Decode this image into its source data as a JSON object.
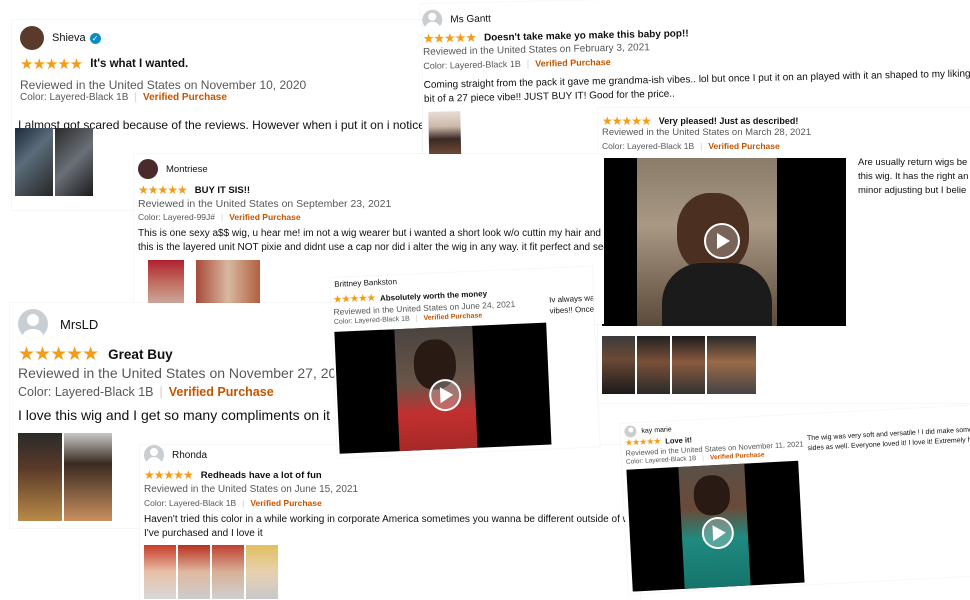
{
  "colors": {
    "star": "#f59b14",
    "verified": "#c45500",
    "meta": "#565959"
  },
  "reviews": {
    "shieva": {
      "name": "Shieva",
      "stars": "★★★★★",
      "title": "It's what I wanted.",
      "meta": "Reviewed in the United States on November 10, 2020",
      "variant": "Color: Layered-Black 1B",
      "verified": "Verified Purchase",
      "body": "I almost got scared because of the reviews. However when i put it on i noticed it"
    },
    "gantt": {
      "name": "Ms Gantt",
      "stars": "★★★★★",
      "title": "Doesn't take make yo make this baby pop!!",
      "meta": "Reviewed in the United States on February 3, 2021",
      "variant": "Color: Layered-Black 1B",
      "verified": "Verified Purchase",
      "body1": "Coming straight from the pack it gave me grandma-ish vibes.. lol but once I put it on an played with it an shaped to my liking, di",
      "body2": "bit of a 27 piece vibe!! JUST BUY IT! Good for the price.."
    },
    "pleased": {
      "stars": "★★★★★",
      "title": "Very pleased! Just as described!",
      "meta": "Reviewed in the United States on March 28, 2021",
      "variant": "Color: Layered-Black 1B",
      "verified": "Verified Purchase",
      "side1": "Are usually return wigs be",
      "side2": "this wig. It has the right an",
      "side3": "minor adjusting but I belie"
    },
    "montriese": {
      "name": "Montriese",
      "stars": "★★★★★",
      "title": "BUY IT SIS!!",
      "meta": "Reviewed in the United States on September 23, 2021",
      "variant": "Color: Layered-99J#",
      "verified": "Verified Purchase",
      "body1": "This is one sexy a$$ wig, u hear me! im not a wig wearer but i wanted a short look w/o cuttin my hair and t",
      "body2": "this is the layered unit NOT pixie and didnt use a cap nor did i alter the wig in any way. it fit perfect and sec"
    },
    "brittney": {
      "name": "Brittney Bankston",
      "stars": "★★★★★",
      "title": "Absolutely worth the money",
      "meta": "Reviewed in the United States on June 24, 2021",
      "variant": "Color: Layered-Black 1B",
      "verified": "Verified Purchase",
      "side1": "Iv always wa",
      "side2": "vibes!! Once"
    },
    "mrsld": {
      "name": "MrsLD",
      "stars": "★★★★★",
      "title": "Great Buy",
      "meta": "Reviewed in the United States on November 27, 20",
      "variant": "Color: Layered-Black 1B",
      "verified": "Verified Purchase",
      "body": "I love this wig and I get so many compliments on it"
    },
    "rhonda": {
      "name": "Rhonda",
      "stars": "★★★★★",
      "title": "Redheads have a lot of fun",
      "meta": "Reviewed in the United States on June 15, 2021",
      "variant": "Color: Layered-Black 1B",
      "verified": "Verified Purchase",
      "body1": "Haven't tried this color in a while working in corporate America sometimes you wanna be different outside of work",
      "body2": "I've purchased and I love it"
    },
    "kay": {
      "name": "kay marie",
      "stars": "★★★★★",
      "title": "Love it!",
      "meta": "Reviewed in the United States on November 11, 2021",
      "variant": "Color: Layered-Black 1B",
      "verified": "Verified Purchase",
      "side1": "The wig was very soft and versatile ! I did make some",
      "side2": "sides as well. Everyone loved it! I love it! Extremely ha"
    }
  }
}
